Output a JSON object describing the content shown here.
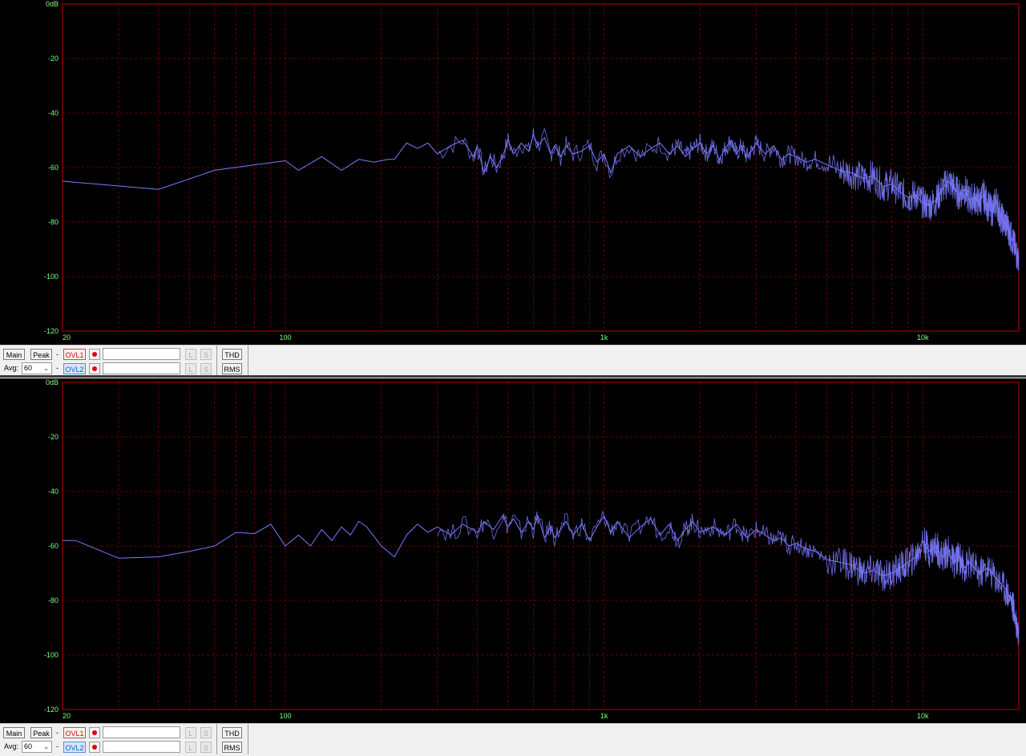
{
  "colors": {
    "grid": "#6a0000",
    "frame": "#c00000",
    "trace": "#7b7bff",
    "axis_text": "#7fff7f"
  },
  "panels": [
    {
      "chart_data": {
        "type": "line",
        "title": "",
        "xlabel": "",
        "ylabel": "",
        "xscale": "log",
        "xlim": [
          20,
          20000
        ],
        "ylim": [
          -120,
          0
        ],
        "ytick_labels": [
          "0dB",
          "-20",
          "-40",
          "-60",
          "-80",
          "-100",
          "-120"
        ],
        "xtick_labels": [
          "20",
          "100",
          "1k",
          "10k"
        ],
        "grid": true,
        "series": [
          {
            "x": [
              20,
              40,
              60,
              80,
              100,
              110,
              130,
              150,
              170,
              190,
              210,
              220,
              240,
              260,
              280,
              300,
              330,
              360,
              390,
              400,
              420,
              440,
              460,
              480,
              500,
              520,
              550,
              580,
              600,
              620,
              650,
              680,
              700,
              730,
              760,
              800,
              850,
              900,
              950,
              1000,
              1050,
              1100,
              1200,
              1300,
              1400,
              1500,
              1600,
              1700,
              1800,
              1900,
              2000,
              2100,
              2200,
              2300,
              2400,
              2500,
              2600,
              2700,
              2800,
              2900,
              3000,
              3200,
              3400,
              3600,
              3800,
              4000,
              4300,
              4600,
              5000,
              5500,
              6000,
              6500,
              7000,
              7500,
              8000,
              8500,
              9000,
              9500,
              10000,
              10500,
              11000,
              11500,
              12000,
              12500,
              13000,
              13500,
              14000,
              14500,
              15000,
              15500,
              16000,
              16500,
              17000,
              17500,
              18000,
              18500,
              19000,
              19500,
              20000
            ],
            "y": [
              -65,
              -68,
              -61,
              -59,
              -57.5,
              -61,
              -56,
              -61,
              -57,
              -58,
              -57,
              -57,
              -51,
              -53,
              -51,
              -55,
              -52,
              -50,
              -56,
              -52,
              -62,
              -56,
              -60,
              -56,
              -50,
              -55,
              -51,
              -54,
              -48,
              -52,
              -49,
              -55,
              -52,
              -56,
              -52,
              -55,
              -54,
              -52,
              -58,
              -55,
              -62,
              -55,
              -52,
              -56,
              -53,
              -51,
              -55,
              -52,
              -56,
              -53,
              -51,
              -55,
              -52,
              -57,
              -53,
              -50,
              -55,
              -52,
              -56,
              -54,
              -51,
              -55,
              -52,
              -57,
              -55,
              -56,
              -58,
              -57,
              -59,
              -61,
              -62,
              -64,
              -63,
              -67,
              -66,
              -69,
              -71,
              -70,
              -73,
              -74,
              -72,
              -68,
              -65,
              -67,
              -70,
              -68,
              -72,
              -71,
              -73,
              -70,
              -74,
              -76,
              -72,
              -78,
              -80,
              -82,
              -86,
              -90,
              -94
            ]
          }
        ]
      },
      "toolbar": {
        "main": "Main",
        "peak": "Peak",
        "dash1": "-",
        "ovl1": "OVL1",
        "avg_label": "Avg:",
        "avg_value": "60",
        "dash2": "-",
        "ovl2": "OVL2",
        "l1": "L",
        "s1": "S",
        "l2": "L",
        "s2": "S",
        "thd": "THD",
        "rms": "RMS"
      }
    },
    {
      "chart_data": {
        "type": "line",
        "title": "",
        "xlabel": "",
        "ylabel": "",
        "xscale": "log",
        "xlim": [
          20,
          20000
        ],
        "ylim": [
          -120,
          0
        ],
        "ytick_labels": [
          "0dB",
          "-20",
          "-40",
          "-60",
          "-80",
          "-100",
          "-120"
        ],
        "xtick_labels": [
          "20",
          "100",
          "1k",
          "10k"
        ],
        "grid": true,
        "series": [
          {
            "x": [
              20,
              22,
              30,
              40,
              50,
              60,
              70,
              80,
              90,
              100,
              110,
              120,
              130,
              140,
              150,
              160,
              170,
              180,
              200,
              220,
              240,
              260,
              280,
              300,
              330,
              360,
              400,
              420,
              450,
              480,
              500,
              520,
              550,
              580,
              600,
              620,
              650,
              680,
              700,
              730,
              760,
              800,
              850,
              900,
              950,
              1000,
              1050,
              1100,
              1200,
              1300,
              1400,
              1500,
              1600,
              1700,
              1800,
              1900,
              2000,
              2200,
              2400,
              2600,
              2800,
              3000,
              3200,
              3400,
              3600,
              3800,
              4000,
              4300,
              4600,
              5000,
              5500,
              6000,
              6500,
              7000,
              7500,
              8000,
              8500,
              9000,
              9500,
              10000,
              10500,
              11000,
              11500,
              12000,
              12500,
              13000,
              13500,
              14000,
              15000,
              16000,
              17000,
              18000,
              19000,
              19500,
              20000
            ],
            "y": [
              -58,
              -58,
              -64.5,
              -64,
              -62,
              -60,
              -55,
              -55.5,
              -52,
              -60,
              -56,
              -60,
              -54,
              -58,
              -53,
              -56,
              -51,
              -53,
              -60,
              -64,
              -56,
              -52,
              -55,
              -53,
              -56,
              -52,
              -55,
              -51,
              -54,
              -49,
              -53,
              -50,
              -55,
              -51,
              -54,
              -49,
              -57,
              -53,
              -57,
              -54,
              -51,
              -56,
              -52,
              -58,
              -53,
              -49,
              -55,
              -51,
              -57,
              -53,
              -50,
              -56,
              -52,
              -58,
              -54,
              -51,
              -55,
              -53,
              -56,
              -52,
              -57,
              -54,
              -56,
              -58,
              -57,
              -60,
              -59,
              -61,
              -62,
              -65,
              -66,
              -67,
              -70,
              -69,
              -71,
              -70,
              -68,
              -66,
              -64,
              -58,
              -62,
              -60,
              -64,
              -62,
              -66,
              -64,
              -68,
              -66,
              -70,
              -68,
              -72,
              -75,
              -80,
              -86,
              -92
            ]
          }
        ]
      },
      "toolbar": {
        "main": "Main",
        "peak": "Peak",
        "dash1": "-",
        "ovl1": "OVL1",
        "avg_label": "Avg:",
        "avg_value": "60",
        "dash2": "-",
        "ovl2": "OVL2",
        "l1": "L",
        "s1": "S",
        "l2": "L",
        "s2": "S",
        "thd": "THD",
        "rms": "RMS"
      }
    }
  ]
}
